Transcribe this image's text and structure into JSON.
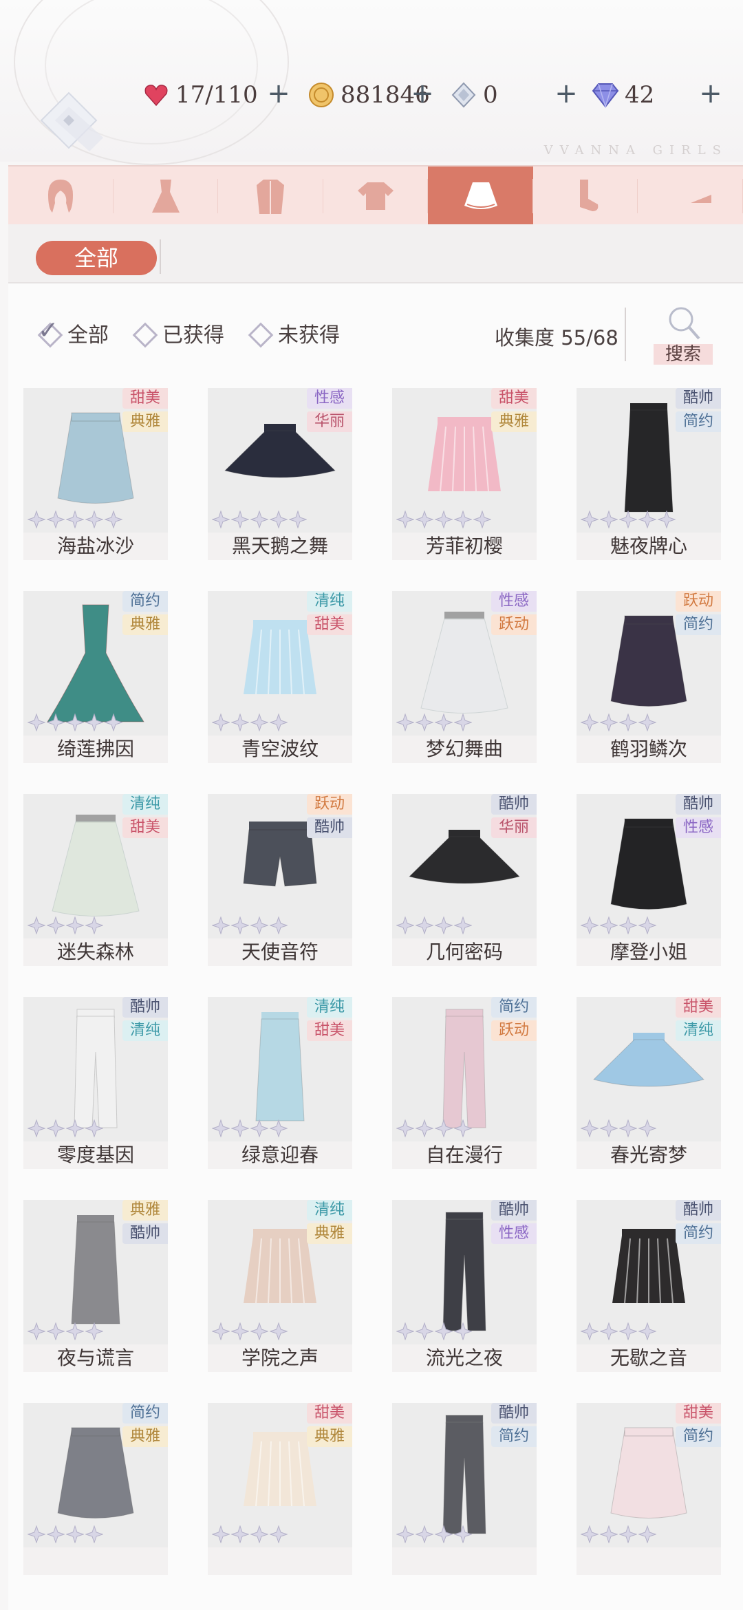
{
  "resources": [
    {
      "icon": "heart-stamina-icon",
      "value": "17/110",
      "color": "#e0435f"
    },
    {
      "icon": "gold-coin-icon",
      "value": "881846",
      "color": "#e1aa4a"
    },
    {
      "icon": "crystal-icon",
      "value": "0",
      "color": "#9aa4b8"
    },
    {
      "icon": "diamond-icon",
      "value": "42",
      "color": "#6b6fd6"
    }
  ],
  "brand": "VVANNA GIRLS",
  "categories": [
    "hair-icon",
    "dress-icon",
    "coat-icon",
    "top-icon",
    "skirt-icon",
    "socks-icon",
    "more-icon"
  ],
  "active_category": 4,
  "subtab": {
    "label": "全部"
  },
  "filters": [
    {
      "label": "全部",
      "checked": true
    },
    {
      "label": "已获得",
      "checked": false
    },
    {
      "label": "未获得",
      "checked": false
    }
  ],
  "collection": {
    "label": "收集度",
    "value": "55/68"
  },
  "search": {
    "label": "搜索"
  },
  "tag_colors": {
    "甜美": {
      "bg": "#f6dede",
      "fg": "#c9546a"
    },
    "典雅": {
      "bg": "#f7ecd2",
      "fg": "#b0873b"
    },
    "性感": {
      "bg": "#e8e0f3",
      "fg": "#8b67c4"
    },
    "华丽": {
      "bg": "#f5dce0",
      "fg": "#b9546c"
    },
    "酷帅": {
      "bg": "#dde0ea",
      "fg": "#4a5270"
    },
    "简约": {
      "bg": "#dfe7f0",
      "fg": "#4f7196"
    },
    "清纯": {
      "bg": "#dcf0f2",
      "fg": "#3e9aa8"
    },
    "跃动": {
      "bg": "#fbe3d3",
      "fg": "#d27a41"
    }
  },
  "items": [
    {
      "name": "海盐冰沙",
      "tags": [
        "甜美",
        "典雅"
      ],
      "stars": 5,
      "color": "#a9c7d6",
      "shape": "skirt"
    },
    {
      "name": "黑天鹅之舞",
      "tags": [
        "性感",
        "华丽"
      ],
      "stars": 5,
      "color": "#2a2d3d",
      "shape": "tutu"
    },
    {
      "name": "芳菲初樱",
      "tags": [
        "甜美",
        "典雅"
      ],
      "stars": 5,
      "color": "#f2b9c6",
      "shape": "pleat"
    },
    {
      "name": "魅夜牌心",
      "tags": [
        "酷帅",
        "简约"
      ],
      "stars": 5,
      "color": "#262628",
      "shape": "long"
    },
    {
      "name": "绮莲拂因",
      "tags": [
        "简约",
        "典雅"
      ],
      "stars": 5,
      "color": "#3f8d86",
      "shape": "gown"
    },
    {
      "name": "青空波纹",
      "tags": [
        "清纯",
        "甜美"
      ],
      "stars": 4,
      "color": "#bfe0f0",
      "shape": "pleat"
    },
    {
      "name": "梦幻舞曲",
      "tags": [
        "性感",
        "跃动"
      ],
      "stars": 4,
      "color": "#e9eaec",
      "shape": "sheer"
    },
    {
      "name": "鹤羽鳞次",
      "tags": [
        "跃动",
        "简约"
      ],
      "stars": 4,
      "color": "#3a3346",
      "shape": "skirt"
    },
    {
      "name": "迷失森林",
      "tags": [
        "清纯",
        "甜美"
      ],
      "stars": 4,
      "color": "#dde7db",
      "shape": "sheer"
    },
    {
      "name": "天使音符",
      "tags": [
        "跃动",
        "酷帅"
      ],
      "stars": 4,
      "color": "#4c505a",
      "shape": "shorts"
    },
    {
      "name": "几何密码",
      "tags": [
        "酷帅",
        "华丽"
      ],
      "stars": 4,
      "color": "#2b2b2d",
      "shape": "tutu"
    },
    {
      "name": "摩登小姐",
      "tags": [
        "酷帅",
        "性感"
      ],
      "stars": 4,
      "color": "#232325",
      "shape": "skirt"
    },
    {
      "name": "零度基因",
      "tags": [
        "酷帅",
        "清纯"
      ],
      "stars": 4,
      "color": "#f1f1f1",
      "shape": "pants"
    },
    {
      "name": "绿意迎春",
      "tags": [
        "清纯",
        "甜美"
      ],
      "stars": 4,
      "color": "#b6d8e4",
      "shape": "long"
    },
    {
      "name": "自在漫行",
      "tags": [
        "简约",
        "跃动"
      ],
      "stars": 4,
      "color": "#e6c8d2",
      "shape": "pants"
    },
    {
      "name": "春光寄梦",
      "tags": [
        "甜美",
        "清纯"
      ],
      "stars": 4,
      "color": "#9fc8e4",
      "shape": "tutu"
    },
    {
      "name": "夜与谎言",
      "tags": [
        "典雅",
        "酷帅"
      ],
      "stars": 4,
      "color": "#8a8a8e",
      "shape": "long"
    },
    {
      "name": "学院之声",
      "tags": [
        "清纯",
        "典雅"
      ],
      "stars": 4,
      "color": "#e6cfc2",
      "shape": "pleat"
    },
    {
      "name": "流光之夜",
      "tags": [
        "酷帅",
        "性感"
      ],
      "stars": 4,
      "color": "#3e3f46",
      "shape": "pants"
    },
    {
      "name": "无歇之音",
      "tags": [
        "酷帅",
        "简约"
      ],
      "stars": 4,
      "color": "#2d2b2c",
      "shape": "pleat"
    },
    {
      "name": "",
      "tags": [
        "简约",
        "典雅"
      ],
      "stars": 4,
      "color": "#7e8088",
      "shape": "skirt"
    },
    {
      "name": "",
      "tags": [
        "甜美",
        "典雅"
      ],
      "stars": 4,
      "color": "#f2e6d8",
      "shape": "pleat"
    },
    {
      "name": "",
      "tags": [
        "酷帅",
        "简约"
      ],
      "stars": 4,
      "color": "#5b5c62",
      "shape": "pants"
    },
    {
      "name": "",
      "tags": [
        "甜美",
        "简约"
      ],
      "stars": 4,
      "color": "#f2dfe2",
      "shape": "skirt"
    }
  ]
}
